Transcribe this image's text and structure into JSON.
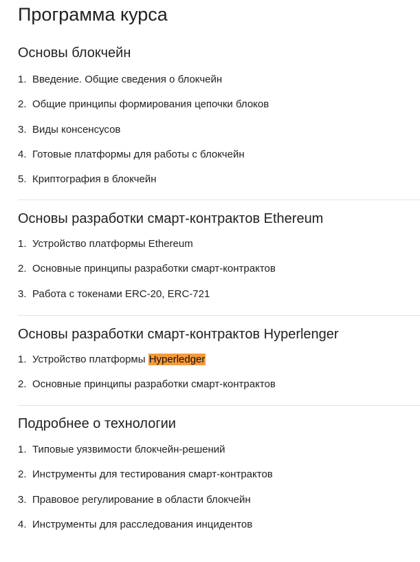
{
  "page": {
    "title": "Программа курса",
    "highlight_color": "#f59a3a"
  },
  "sections": [
    {
      "title": "Основы блокчейн",
      "items": [
        {
          "num": "1.",
          "text": "Введение. Общие сведения о блокчейн"
        },
        {
          "num": "2.",
          "text": "Общие принципы формирования цепочки блоков"
        },
        {
          "num": "3.",
          "text": "Виды консенсусов"
        },
        {
          "num": "4.",
          "text": "Готовые платформы для работы с блокчейн"
        },
        {
          "num": "5.",
          "text": "Криптография в блокчейн"
        }
      ]
    },
    {
      "title": "Основы разработки смарт-контрактов Ethereum",
      "items": [
        {
          "num": "1.",
          "text": "Устройство платформы Ethereum"
        },
        {
          "num": "2.",
          "text": "Основные принципы разработки смарт-контрактов"
        },
        {
          "num": "3.",
          "text": "Работа с токенами ERC-20, ERC-721"
        }
      ]
    },
    {
      "title": "Основы разработки смарт-контрактов Hyperlenger",
      "items": [
        {
          "num": "1.",
          "text": "Устройство платформы ",
          "highlight": "Hyperledger"
        },
        {
          "num": "2.",
          "text": "Основные принципы разработки смарт-контрактов"
        }
      ]
    },
    {
      "title": "Подробнее о технологии",
      "items": [
        {
          "num": "1.",
          "text": "Типовые уязвимости блокчейн-решений"
        },
        {
          "num": "2.",
          "text": "Инструменты для тестирования смарт-контрактов"
        },
        {
          "num": "3.",
          "text": "Правовое регулирование в области блокчейн"
        },
        {
          "num": "4.",
          "text": "Инструменты для расследования инцидентов"
        }
      ]
    }
  ]
}
